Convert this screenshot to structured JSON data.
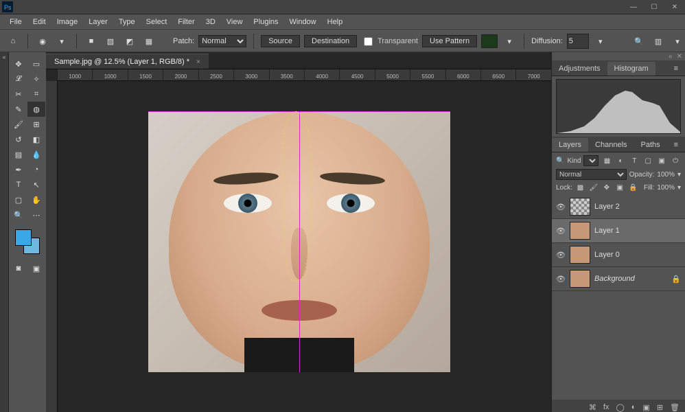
{
  "app": {
    "logo_label": "Ps"
  },
  "window_controls": {
    "min": "—",
    "max": "☐",
    "close": "✕"
  },
  "menu": [
    "File",
    "Edit",
    "Image",
    "Layer",
    "Type",
    "Select",
    "Filter",
    "3D",
    "View",
    "Plugins",
    "Window",
    "Help"
  ],
  "options": {
    "patch_label": "Patch:",
    "mode_options": [
      "Normal"
    ],
    "mode_value": "Normal",
    "source": "Source",
    "destination": "Destination",
    "transparent": "Transparent",
    "use_pattern": "Use Pattern",
    "diffusion_label": "Diffusion:",
    "diffusion_value": "5"
  },
  "doc_tab": {
    "title": "Sample.jpg @ 12.5% (Layer 1, RGB/8) *",
    "close": "×"
  },
  "ruler": [
    "1000",
    "1000",
    "1500",
    "2000",
    "2500",
    "3000",
    "3500",
    "4000",
    "4500",
    "5000",
    "5500",
    "6000",
    "6500",
    "7000"
  ],
  "panels": {
    "adjustments": "Adjustments",
    "histogram": "Histogram",
    "layers": "Layers",
    "channels": "Channels",
    "paths": "Paths"
  },
  "layer_panel": {
    "kind_label": "Kind",
    "blend_mode": "Normal",
    "opacity_label": "Opacity:",
    "opacity_value": "100%",
    "lock_label": "Lock:",
    "fill_label": "Fill:",
    "fill_value": "100%",
    "search_icon": "🔍"
  },
  "layers": [
    {
      "name": "Layer 2",
      "thumb": "tx",
      "visible": true,
      "locked": false
    },
    {
      "name": "Layer 1",
      "thumb": "face",
      "visible": true,
      "locked": false,
      "selected": true
    },
    {
      "name": "Layer 0",
      "thumb": "face",
      "visible": true,
      "locked": false
    },
    {
      "name": "Background",
      "thumb": "face",
      "visible": true,
      "locked": true,
      "bg": true
    }
  ],
  "footer_icons": {
    "link": "⌘",
    "fx": "fx",
    "mask": "◯",
    "adj": "◐",
    "group": "▣",
    "new": "⊞",
    "trash": "🗑"
  },
  "icons": {
    "home": "⌂",
    "tool": "◉",
    "shape1": "■",
    "shape2": "▧",
    "shape3": "◩",
    "shape4": "▦",
    "search": "🔍",
    "workspace": "▥",
    "chev": "▾",
    "menu": "≡",
    "collapse": "«",
    "expand": "»",
    "eye": "👁",
    "lock": "🔒",
    "t": "T"
  }
}
